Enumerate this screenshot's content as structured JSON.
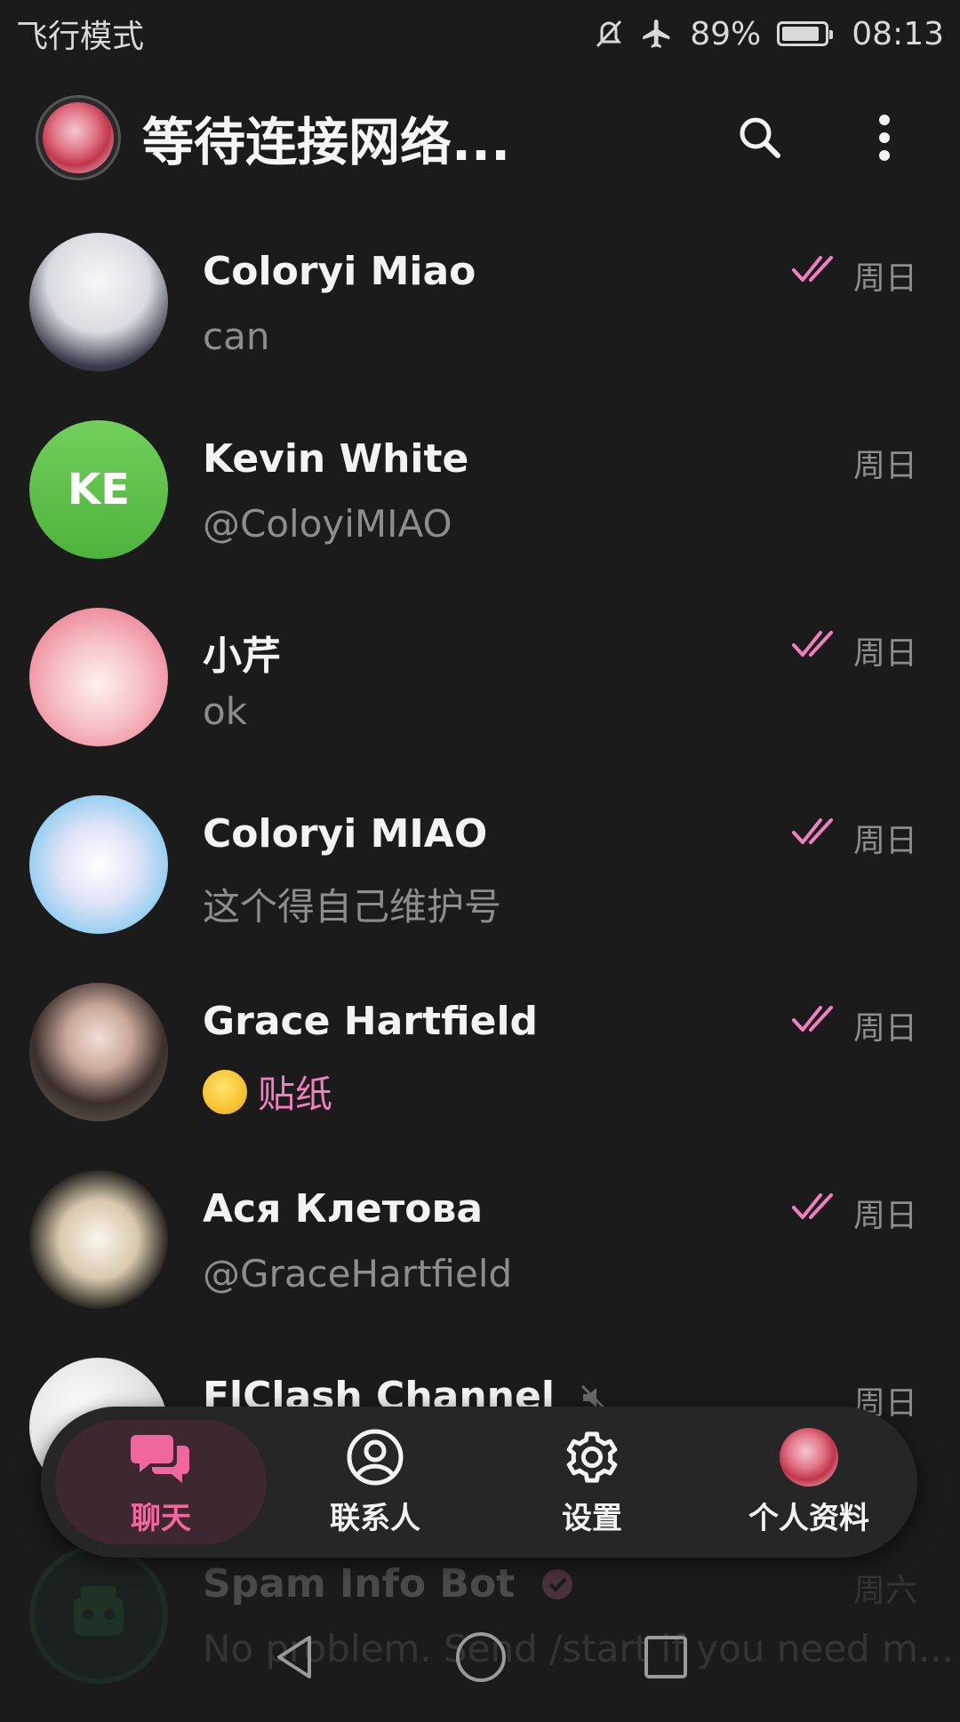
{
  "status_bar": {
    "left_text": "飞行模式",
    "battery": "89%",
    "battery_level": 0.89,
    "time": "08:13"
  },
  "header": {
    "title": "等待连接网络..."
  },
  "chats": [
    {
      "name": "Coloryi Miao",
      "message": "can",
      "time": "周日",
      "read": true
    },
    {
      "name": "Kevin White",
      "initials": "KE",
      "message": "@ColoyiMIAO",
      "time": "周日",
      "read": false
    },
    {
      "name": "小芹",
      "message": "ok",
      "time": "周日",
      "read": true
    },
    {
      "name": "Coloryi MIAO",
      "message": "这个得自己维护号",
      "time": "周日",
      "read": true
    },
    {
      "name": "Grace Hartfield",
      "message": "贴纸",
      "time": "周日",
      "read": true
    },
    {
      "name": "Ася Клетова",
      "message": "@GraceHartfield",
      "time": "周日",
      "read": true
    },
    {
      "name": "FlClash Channel",
      "message": "",
      "time": "周日",
      "read": false
    },
    {
      "name": "Spam Info Bot",
      "message": "No problem. Send /start if you need m...",
      "time": "周六",
      "read": false
    }
  ],
  "bottom_nav": {
    "items": [
      {
        "label": "聊天",
        "icon": "chat-bubbles-icon",
        "active": true
      },
      {
        "label": "联系人",
        "icon": "contacts-icon",
        "active": false
      },
      {
        "label": "设置",
        "icon": "gear-icon",
        "active": false
      },
      {
        "label": "个人资料",
        "icon": "profile-avatar",
        "active": false
      }
    ]
  },
  "colors": {
    "background": "#1b1b1c",
    "accent": "#f0679f",
    "check": "#f07fbd",
    "muted": "#8d8d8d"
  }
}
